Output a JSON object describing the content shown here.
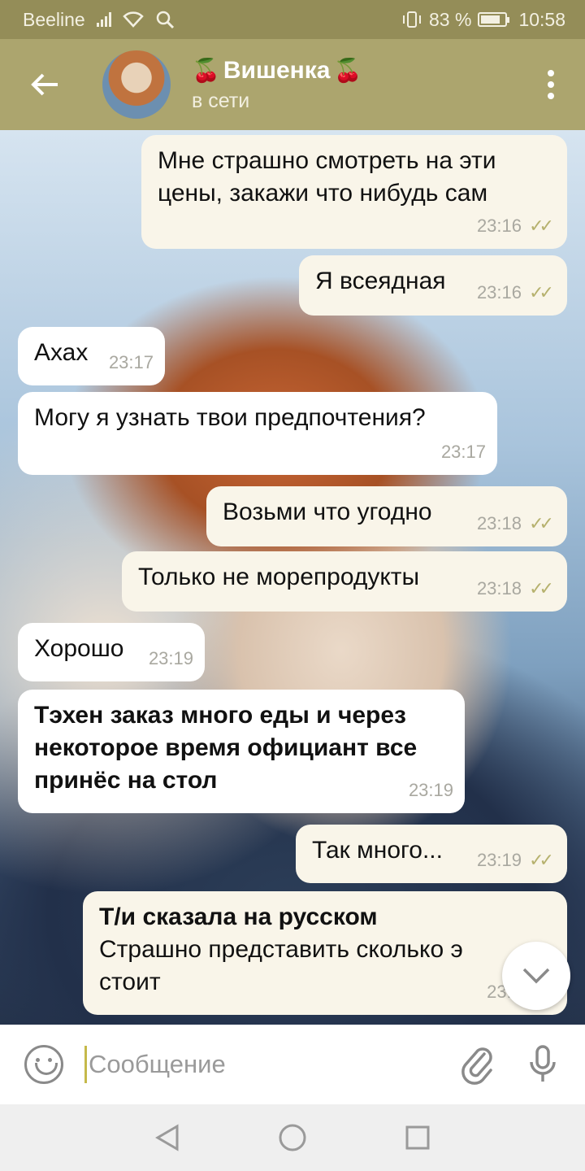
{
  "status_bar": {
    "carrier": "Beeline",
    "battery_text": "83 %",
    "battery_level": 0.83,
    "time": "10:58"
  },
  "header": {
    "contact_name": "Вишенка",
    "name_decoration": "cherry-icon",
    "contact_status": "в сети"
  },
  "messages": [
    {
      "dir": "out",
      "text": "Мне страшно смотреть на эти цены, закажи что нибудь сам",
      "time": "23:16",
      "read": true
    },
    {
      "dir": "out",
      "text": "Я всеядная",
      "time": "23:16",
      "read": true
    },
    {
      "dir": "in",
      "text": "Ахах",
      "time": "23:17"
    },
    {
      "dir": "in",
      "text": "Могу я узнать твои предпочтения?",
      "time": "23:17"
    },
    {
      "dir": "out",
      "text": "Возьми что угодно",
      "time": "23:18",
      "read": true
    },
    {
      "dir": "out",
      "text": "Только не морепродукты",
      "time": "23:18",
      "read": true
    },
    {
      "dir": "in",
      "text": "Хорошо",
      "time": "23:19"
    },
    {
      "dir": "in",
      "text": "Тэхен заказ много еды и через некоторое время официант все принёс на стол",
      "time": "23:19",
      "bold": true
    },
    {
      "dir": "out",
      "text": "Так много...",
      "time": "23:19",
      "read": true
    },
    {
      "dir": "out",
      "text_bold": "Т/и сказала на русском",
      "text": "Страшно представить сколько э стоит",
      "time": "23:2"
    }
  ],
  "input": {
    "placeholder": "Сообщение"
  },
  "colors": {
    "status_bar": "#948d58",
    "header": "#aca56e",
    "outgoing_bubble": "#f9f5e9",
    "incoming_bubble": "#ffffff",
    "read_ticks": "#b6b16e"
  }
}
